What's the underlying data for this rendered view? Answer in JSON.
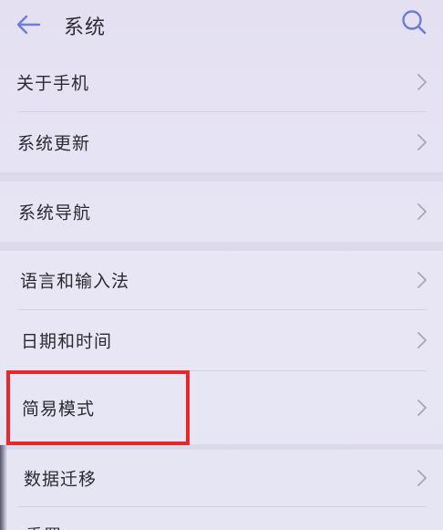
{
  "header": {
    "title": "系统",
    "back_icon": "arrow-left-icon",
    "search_icon": "search-icon"
  },
  "colors": {
    "accent": "#6a7fd0",
    "highlight": "#e8262c",
    "text": "#2a2a30"
  },
  "items": [
    {
      "label": "关于手机"
    },
    {
      "label": "系统更新"
    },
    {
      "label": "系统导航"
    },
    {
      "label": "语言和输入法"
    },
    {
      "label": "日期和时间"
    },
    {
      "label": "简易模式"
    },
    {
      "label": "数据迁移"
    },
    {
      "label": "重置"
    }
  ]
}
